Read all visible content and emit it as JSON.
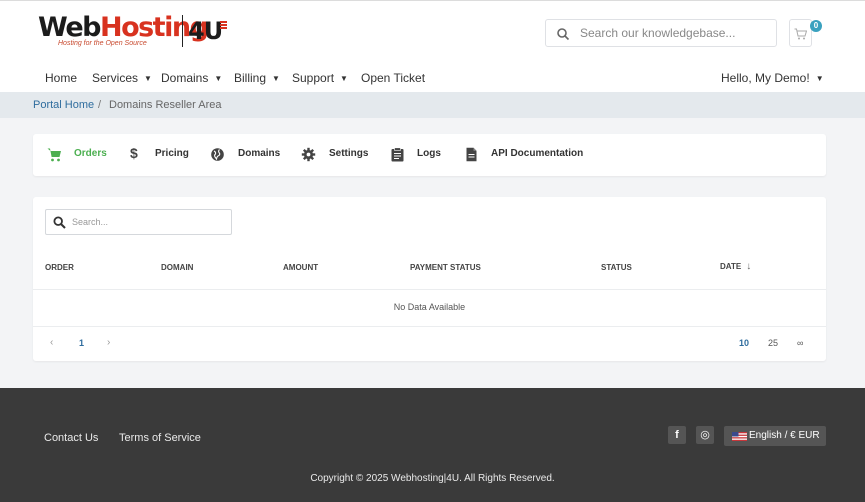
{
  "brand": {
    "name_dark": "Web",
    "name_red": "Hosting",
    "tagline": "Hosting for the Open Source",
    "badge": "4U"
  },
  "header_search": {
    "placeholder": "Search our knowledgebase...",
    "icon": "search-icon"
  },
  "cart": {
    "count": "0",
    "icon": "cart-icon"
  },
  "nav": {
    "items": [
      {
        "label": "Home",
        "dropdown": false
      },
      {
        "label": "Services",
        "dropdown": true
      },
      {
        "label": "Domains",
        "dropdown": true
      },
      {
        "label": "Billing",
        "dropdown": true
      },
      {
        "label": "Support",
        "dropdown": true
      },
      {
        "label": "Open Ticket",
        "dropdown": false
      }
    ],
    "account": "Hello, My Demo!"
  },
  "breadcrumb": {
    "items": [
      "Portal Home",
      "Domains Reseller Area"
    ],
    "separator": "/"
  },
  "tabs": [
    {
      "label": "Orders",
      "icon": "cart-icon",
      "active": true
    },
    {
      "label": "Pricing",
      "icon": "dollar-icon",
      "active": false
    },
    {
      "label": "Domains",
      "icon": "globe-icon",
      "active": false
    },
    {
      "label": "Settings",
      "icon": "gear-icon",
      "active": false
    },
    {
      "label": "Logs",
      "icon": "clipboard-icon",
      "active": false
    },
    {
      "label": "API Documentation",
      "icon": "document-icon",
      "active": false
    }
  ],
  "table": {
    "search_placeholder": "Search...",
    "columns": [
      "ORDER",
      "DOMAIN",
      "AMOUNT",
      "PAYMENT STATUS",
      "STATUS",
      "DATE"
    ],
    "sort_indicator": "↓",
    "empty_text": "No Data Available",
    "pagination": {
      "prev": "‹",
      "current": "1",
      "next": "›"
    },
    "page_sizes": [
      "10",
      "25",
      "∞"
    ],
    "page_size_selected": "10"
  },
  "footer": {
    "links": [
      "Contact Us",
      "Terms of Service"
    ],
    "social": [
      {
        "icon": "facebook-icon",
        "glyph": "f"
      },
      {
        "icon": "instagram-icon",
        "glyph": "◎"
      }
    ],
    "language": "English / € EUR",
    "copyright": "Copyright © 2025 Webhosting|4U. All Rights Reserved."
  },
  "colors": {
    "accent_green": "#4caf50",
    "link_blue": "#2f6d9e",
    "brand_red": "#d8321f",
    "footer_bg": "#3a3a3a",
    "cart_badge": "#3aa1bf"
  }
}
